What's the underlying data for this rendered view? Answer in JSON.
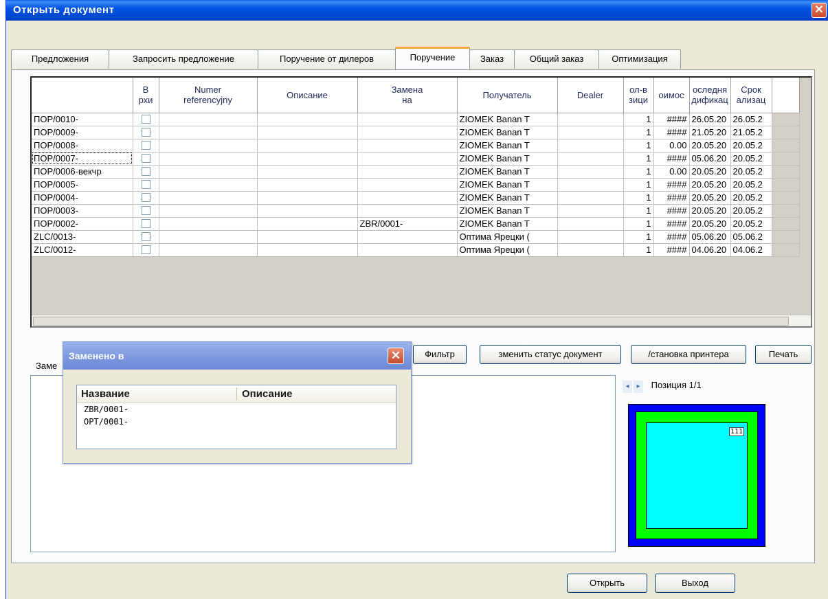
{
  "window": {
    "title": "Открыть документ",
    "close_glyph": "✕"
  },
  "tabs": [
    {
      "label": "Предложения"
    },
    {
      "label": "Запросить предложение"
    },
    {
      "label": "Поручение от дилеров"
    },
    {
      "label": "Поручение",
      "active": true
    },
    {
      "label": "Заказ"
    },
    {
      "label": "Общий заказ"
    },
    {
      "label": "Оптимизация"
    }
  ],
  "grid": {
    "columns": [
      "",
      "В\nрхи",
      "Numer\nreferencyjny",
      "Описание",
      "Замена\nна",
      "Получатель",
      "Dealer",
      "ол-в\nзици",
      "оимос",
      "оследня\nдификац",
      "Срок\nализац"
    ],
    "rows": [
      [
        "ПОР/0010-",
        "",
        "",
        "",
        "",
        "ZIOMEK Banan T",
        "",
        "1",
        "####",
        "26.05.20",
        "26.05.2"
      ],
      [
        "ПОР/0009-",
        "",
        "",
        "",
        "",
        "ZIOMEK Banan T",
        "",
        "1",
        "####",
        "21.05.20",
        "21.05.2"
      ],
      [
        "ПОР/0008-",
        "",
        "",
        "",
        "",
        "ZIOMEK Banan T",
        "",
        "1",
        "0.00",
        "20.05.20",
        "20.05.2"
      ],
      [
        "ПОР/0007-",
        "",
        "",
        "",
        "",
        "ZIOMEK Banan T",
        "",
        "1",
        "####",
        "05.06.20",
        "20.05.2"
      ],
      [
        "ПОР/0006-векчр",
        "",
        "",
        "",
        "",
        "ZIOMEK Banan T",
        "",
        "1",
        "0.00",
        "20.05.20",
        "20.05.2"
      ],
      [
        "ПОР/0005-",
        "",
        "",
        "",
        "",
        "ZIOMEK Banan T",
        "",
        "1",
        "####",
        "20.05.20",
        "20.05.2"
      ],
      [
        "ПОР/0004-",
        "",
        "",
        "",
        "",
        "ZIOMEK Banan T",
        "",
        "1",
        "####",
        "20.05.20",
        "20.05.2"
      ],
      [
        "ПОР/0003-",
        "",
        "",
        "",
        "",
        "ZIOMEK Banan T",
        "",
        "1",
        "####",
        "20.05.20",
        "20.05.2"
      ],
      [
        "ПОР/0002-",
        "",
        "",
        "",
        "ZBR/0001-",
        "ZIOMEK Banan T",
        "",
        "1",
        "####",
        "20.05.20",
        "20.05.2"
      ],
      [
        "ZLC/0013-",
        "",
        "",
        "",
        "",
        "Оптима Ярецки (",
        "",
        "1",
        "####",
        "05.06.20",
        "05.06.2"
      ],
      [
        "ZLC/0012-",
        "",
        "",
        "",
        "",
        "Оптима Ярецки (",
        "",
        "1",
        "####",
        "04.06.20",
        "04.06.2"
      ]
    ]
  },
  "buttons": {
    "filter": "Фильтр",
    "change_status": "зменить статус документ",
    "printer_setup": "/становка принтера",
    "print": "Печать",
    "open": "Открыть",
    "exit": "Выход"
  },
  "bottom": {
    "label": "Заме"
  },
  "preview": {
    "position_text": "Позиция 1/1",
    "label": "111",
    "prev_glyph": "◂",
    "next_glyph": "▸"
  },
  "popup": {
    "title": "Заменено в",
    "col_name": "Название",
    "col_desc": "Описание",
    "items": [
      "ZBR/0001-",
      "OPT/0001-"
    ],
    "close_glyph": "✕"
  }
}
